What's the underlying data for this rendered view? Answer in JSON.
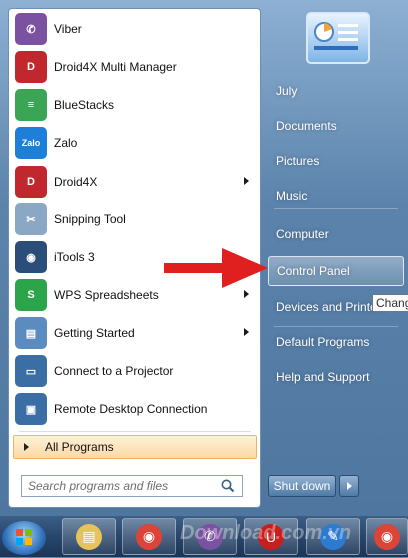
{
  "programs": [
    {
      "label": "Viber",
      "icon": "viber-icon",
      "color": "#7b51a2",
      "glyph": "✆",
      "has_submenu": false
    },
    {
      "label": "Droid4X Multi Manager",
      "icon": "droid4x-multi-manager-icon",
      "color": "#c0282d",
      "glyph": "D",
      "has_submenu": false
    },
    {
      "label": "BlueStacks",
      "icon": "bluestacks-icon",
      "color": "#3aa655",
      "glyph": "≡",
      "has_submenu": false
    },
    {
      "label": "Zalo",
      "icon": "zalo-icon",
      "color": "#1d7fd8",
      "glyph": "Zalo",
      "has_submenu": false
    },
    {
      "label": "Droid4X",
      "icon": "droid4x-icon",
      "color": "#c0282d",
      "glyph": "D",
      "has_submenu": true
    },
    {
      "label": "Snipping Tool",
      "icon": "snipping-tool-icon",
      "color": "#8aa7c4",
      "glyph": "✂",
      "has_submenu": false
    },
    {
      "label": "iTools 3",
      "icon": "itools-icon",
      "color": "#2b4d7a",
      "glyph": "◉",
      "has_submenu": false
    },
    {
      "label": "WPS Spreadsheets",
      "icon": "wps-spreadsheets-icon",
      "color": "#2ca44a",
      "glyph": "S",
      "has_submenu": true
    },
    {
      "label": "Getting Started",
      "icon": "getting-started-icon",
      "color": "#5c8bc0",
      "glyph": "▤",
      "has_submenu": true
    },
    {
      "label": "Connect to a Projector",
      "icon": "projector-icon",
      "color": "#3b6ea5",
      "glyph": "▭",
      "has_submenu": false
    },
    {
      "label": "Remote Desktop Connection",
      "icon": "remote-desktop-icon",
      "color": "#3b6ea5",
      "glyph": "▣",
      "has_submenu": false
    }
  ],
  "all_programs_label": "All Programs",
  "search": {
    "placeholder": "Search programs and files"
  },
  "right_links": [
    {
      "label": "July",
      "highlight": false
    },
    {
      "label": "Documents",
      "highlight": false
    },
    {
      "label": "Pictures",
      "highlight": false
    },
    {
      "label": "Music",
      "highlight": false
    },
    {
      "label": "Computer",
      "highlight": false
    },
    {
      "label": "Control Panel",
      "highlight": true
    },
    {
      "label": "Devices and Printers",
      "highlight": false
    },
    {
      "label": "Default Programs",
      "highlight": false
    },
    {
      "label": "Help and Support",
      "highlight": false
    }
  ],
  "tooltip": "Change",
  "shutdown_label": "Shut down",
  "watermark": "Download.com.vn",
  "taskbar_items": [
    "explorer-icon",
    "chrome-icon",
    "viber-icon",
    "unikey-icon",
    "feather-icon",
    "chrome-icon"
  ],
  "colors": {
    "arrow": "#e0201f",
    "highlight_bg": "#fbd9a4"
  }
}
